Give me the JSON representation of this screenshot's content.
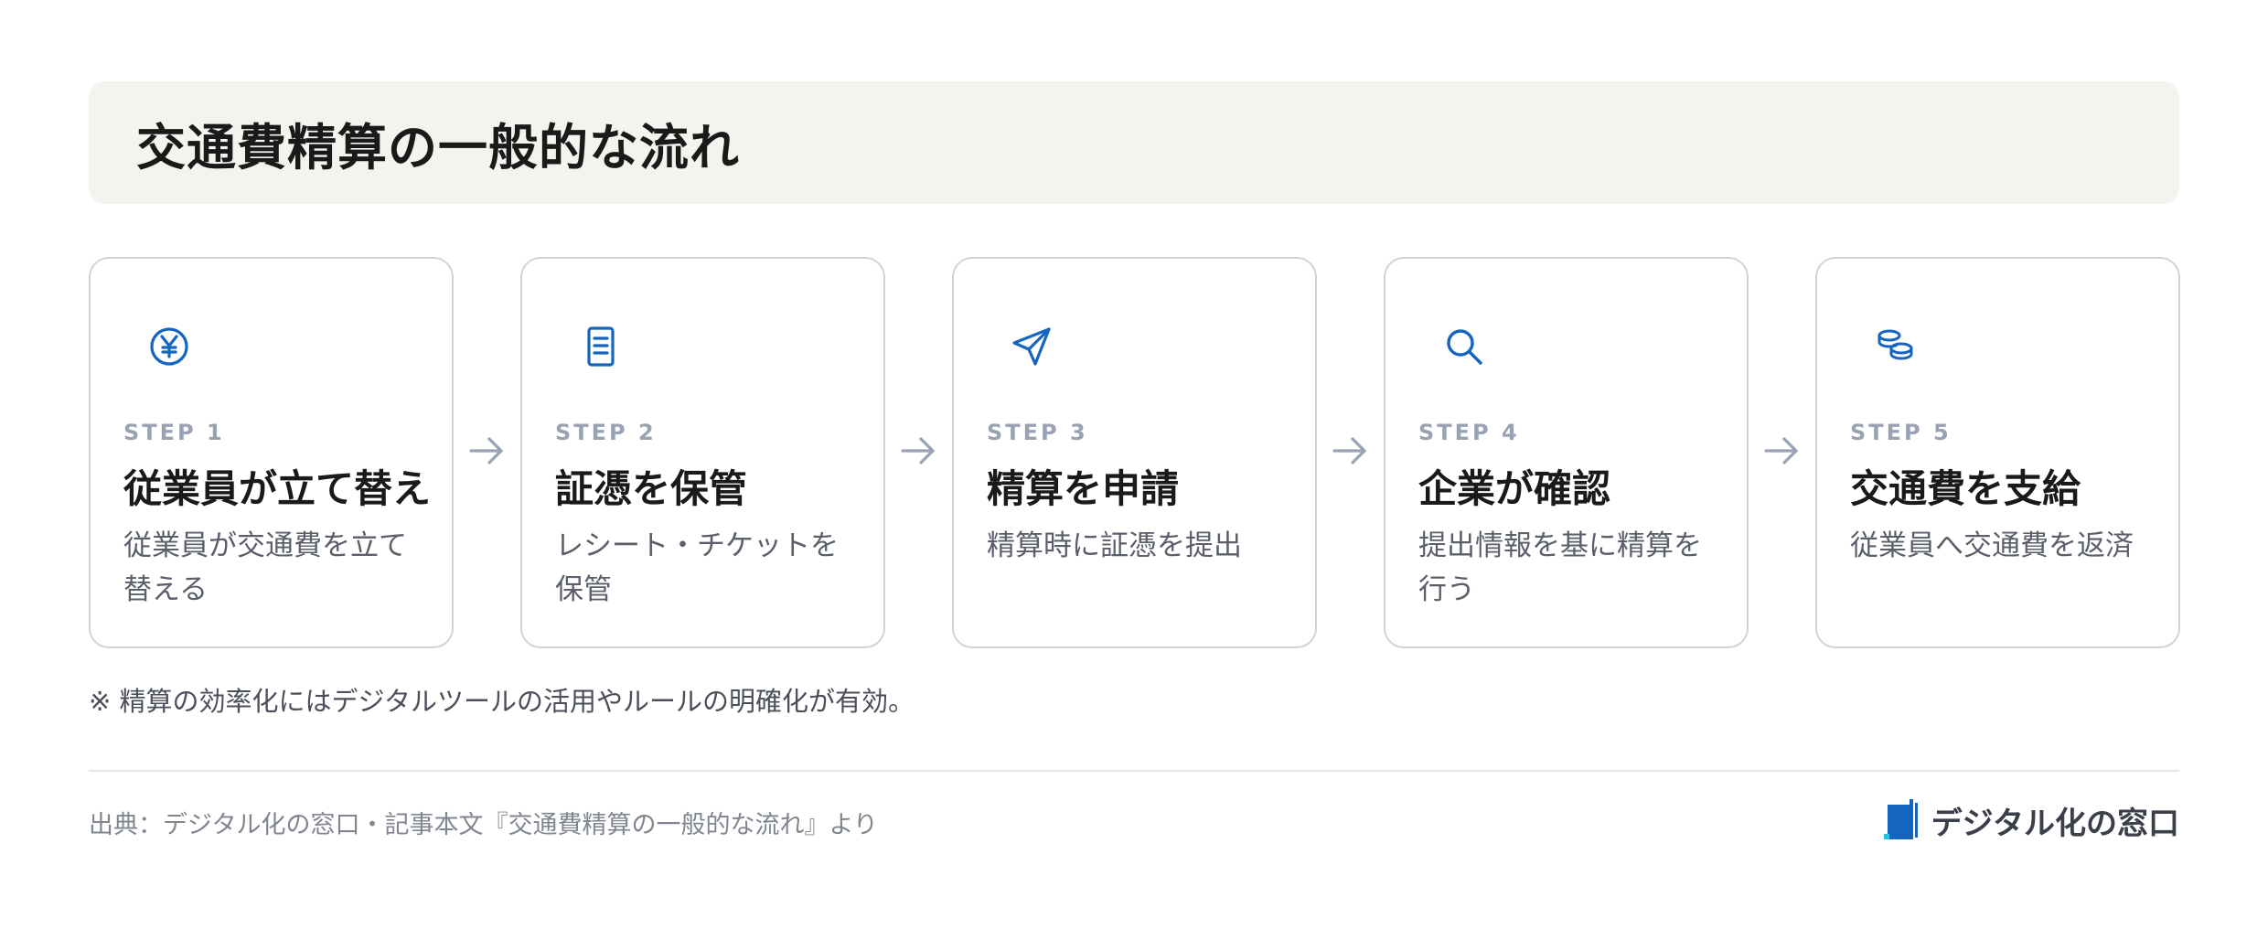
{
  "title": "交通費精算の一般的な流れ",
  "colors": {
    "accent": "#1565c0",
    "step_label": "#98a2b3",
    "title_bg": "#f5f3ee",
    "card_border": "#cfd2d8"
  },
  "steps": [
    {
      "label": "STEP 1",
      "title": "従業員が立て替え",
      "desc": "従業員が交通費を立て替える",
      "icon": "yen-coin-icon"
    },
    {
      "label": "STEP 2",
      "title": "証憑を保管",
      "desc": "レシート・チケットを保管",
      "icon": "document-icon"
    },
    {
      "label": "STEP 3",
      "title": "精算を申請",
      "desc": "精算時に証憑を提出",
      "icon": "send-icon"
    },
    {
      "label": "STEP 4",
      "title": "企業が確認",
      "desc": "提出情報を基に精算を行う",
      "icon": "search-icon"
    },
    {
      "label": "STEP 5",
      "title": "交通費を支給",
      "desc": "従業員へ交通費を返済",
      "icon": "coins-icon"
    }
  ],
  "note": "※ 精算の効率化にはデジタルツールの活用やルールの明確化が有効。",
  "source": "出典：デジタル化の窓口・記事本文『交通費精算の一般的な流れ』より",
  "brand": "デジタル化の窓口"
}
